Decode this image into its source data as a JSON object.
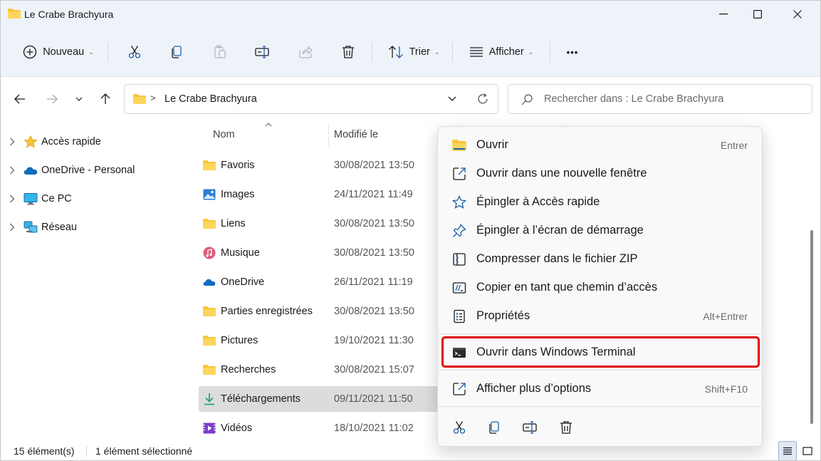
{
  "window": {
    "title": "Le Crabe Brachyura"
  },
  "commandbar": {
    "new_label": "Nouveau",
    "sort_label": "Trier",
    "view_label": "Afficher",
    "more_label": "•••"
  },
  "address": {
    "path_separator": ">",
    "current_folder": "Le Crabe Brachyura",
    "search_placeholder": "Rechercher dans : Le Crabe Brachyura"
  },
  "navpane": {
    "items": [
      {
        "label": "Accès rapide",
        "icon": "star-icon"
      },
      {
        "label": "OneDrive - Personal",
        "icon": "cloud-icon"
      },
      {
        "label": "Ce PC",
        "icon": "computer-icon"
      },
      {
        "label": "Réseau",
        "icon": "network-icon"
      }
    ]
  },
  "content": {
    "columns": {
      "name": "Nom",
      "modified": "Modifié le"
    },
    "files": [
      {
        "name": "Favoris",
        "date": "30/08/2021 13:50",
        "icon": "folder-icon"
      },
      {
        "name": "Images",
        "date": "24/11/2021 11:49",
        "icon": "image-icon"
      },
      {
        "name": "Liens",
        "date": "30/08/2021 13:50",
        "icon": "folder-icon"
      },
      {
        "name": "Musique",
        "date": "30/08/2021 13:50",
        "icon": "music-icon"
      },
      {
        "name": "OneDrive",
        "date": "26/11/2021 11:19",
        "icon": "cloud-icon"
      },
      {
        "name": "Parties enregistrées",
        "date": "30/08/2021 13:50",
        "icon": "folder-icon"
      },
      {
        "name": "Pictures",
        "date": "19/10/2021 11:30",
        "icon": "folder-icon"
      },
      {
        "name": "Recherches",
        "date": "30/08/2021 15:07",
        "icon": "folder-icon"
      },
      {
        "name": "Téléchargements",
        "date": "09/11/2021 11:50",
        "icon": "download-icon",
        "selected": true
      },
      {
        "name": "Vidéos",
        "date": "18/10/2021 11:02",
        "icon": "video-icon"
      }
    ]
  },
  "statusbar": {
    "count": "15 élément(s)",
    "selection": "1 élément sélectionné"
  },
  "context_menu": {
    "items": [
      {
        "label": "Ouvrir",
        "shortcut": "Entrer",
        "icon": "folder-icon"
      },
      {
        "label": "Ouvrir dans une nouvelle fenêtre",
        "shortcut": "",
        "icon": "open-new-window-icon"
      },
      {
        "label": "Épingler à Accès rapide",
        "shortcut": "",
        "icon": "star-outline-icon"
      },
      {
        "label": "Épingler à l’écran de démarrage",
        "shortcut": "",
        "icon": "pin-icon"
      },
      {
        "label": "Compresser dans le fichier ZIP",
        "shortcut": "",
        "icon": "zip-icon"
      },
      {
        "label": "Copier en tant que chemin d’accès",
        "shortcut": "",
        "icon": "copy-path-icon"
      },
      {
        "label": "Propriétés",
        "shortcut": "Alt+Entrer",
        "icon": "properties-icon"
      },
      {
        "label": "Ouvrir dans Windows Terminal",
        "shortcut": "",
        "icon": "terminal-icon",
        "highlighted": true
      },
      {
        "label": "Afficher plus d’options",
        "shortcut": "Shift+F10",
        "icon": "more-options-icon"
      }
    ]
  },
  "colors": {
    "accent": "#0067c0",
    "folder": "#f8c43a",
    "highlight_border": "#e00000"
  }
}
